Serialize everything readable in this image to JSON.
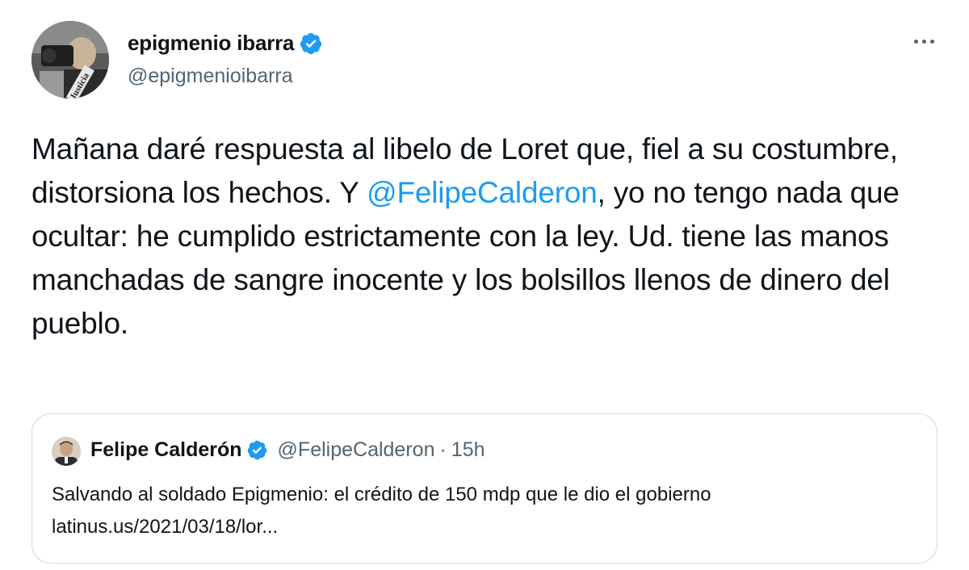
{
  "author": {
    "name": "epigmenio ibarra",
    "handle": "@epigmenioibarra",
    "verified": true,
    "avatar_badge_text": "Justicia"
  },
  "tweet": {
    "text_part1": "Mañana daré respuesta al libelo de Loret que, fiel a su costumbre, distorsiona los hechos. Y ",
    "mention": "@FelipeCalderon",
    "text_part2": ", yo no tengo nada que ocultar: he cumplido estrictamente con la ley. Ud. tiene las manos manchadas de sangre inocente y los bolsillos llenos de dinero del pueblo."
  },
  "quoted_tweet": {
    "name": "Felipe Calderón",
    "handle": "@FelipeCalderon",
    "separator": "·",
    "time": "15h",
    "verified": true,
    "text_line1": "Salvando al soldado Epigmenio: el crédito de 150 mdp que le dio el gobierno",
    "text_line2": "latinus.us/2021/03/18/lor..."
  },
  "icons": {
    "verified": "verified-badge-icon",
    "more": "more-options-icon"
  },
  "colors": {
    "accent": "#1d9bf0",
    "text": "#0f1419",
    "secondary": "#536471",
    "border": "#cfd9de"
  }
}
